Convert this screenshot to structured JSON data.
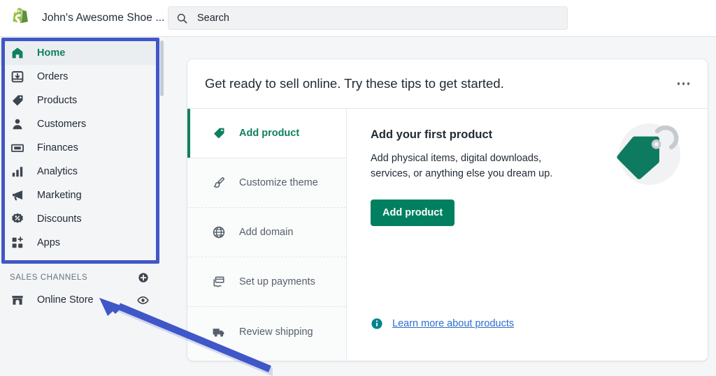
{
  "topbar": {
    "logo_icon": "shopify-bag-icon",
    "store_name": "John's Awesome Shoe ...",
    "search": {
      "icon": "search-icon",
      "placeholder": "Search",
      "value": "Search"
    }
  },
  "sidebar": {
    "items": [
      {
        "label": "Home",
        "icon": "home-icon",
        "active": true
      },
      {
        "label": "Orders",
        "icon": "orders-inbox-icon",
        "active": false
      },
      {
        "label": "Products",
        "icon": "product-tag-icon",
        "active": false
      },
      {
        "label": "Customers",
        "icon": "person-icon",
        "active": false
      },
      {
        "label": "Finances",
        "icon": "cash-icon",
        "active": false
      },
      {
        "label": "Analytics",
        "icon": "bar-chart-icon",
        "active": false
      },
      {
        "label": "Marketing",
        "icon": "megaphone-icon",
        "active": false
      },
      {
        "label": "Discounts",
        "icon": "discount-badge-icon",
        "active": false
      },
      {
        "label": "Apps",
        "icon": "apps-grid-plus-icon",
        "active": false
      }
    ],
    "sales_channels": {
      "title": "SALES CHANNELS",
      "add_icon": "circle-plus-icon",
      "channels": [
        {
          "label": "Online Store",
          "icon": "storefront-icon",
          "action_icon": "eye-icon"
        }
      ]
    }
  },
  "main": {
    "card": {
      "title": "Get ready to sell online. Try these tips to get started.",
      "menu_icon": "ellipsis-icon",
      "tasks": [
        {
          "label": "Add product",
          "icon": "product-tag-icon",
          "active": true
        },
        {
          "label": "Customize theme",
          "icon": "paintbrush-icon",
          "active": false
        },
        {
          "label": "Add domain",
          "icon": "globe-icon",
          "active": false
        },
        {
          "label": "Set up payments",
          "icon": "payment-card-icon",
          "active": false
        },
        {
          "label": "Review shipping",
          "icon": "truck-icon",
          "active": false
        }
      ],
      "detail": {
        "heading": "Add your first product",
        "body": "Add physical items, digital downloads, services, or anything else you dream up.",
        "button_label": "Add product",
        "learn_more": {
          "icon": "info-circle-icon",
          "label": "Learn more about products"
        },
        "illustration": "product-tag-illustration"
      }
    }
  },
  "annotations": {
    "highlight_box": {
      "color": "#4057c8",
      "target": "main-navigation"
    },
    "arrow": {
      "color": "#4057c8",
      "points_to": "Online Store"
    }
  },
  "colors": {
    "brand_green": "#108060",
    "button_green": "#008060",
    "link_blue": "#2c6ecb",
    "info_teal": "#00848e",
    "annotation_blue": "#4057c8",
    "page_bg": "#f4f6f8",
    "sidebar_bg": "#f4f5f7"
  }
}
